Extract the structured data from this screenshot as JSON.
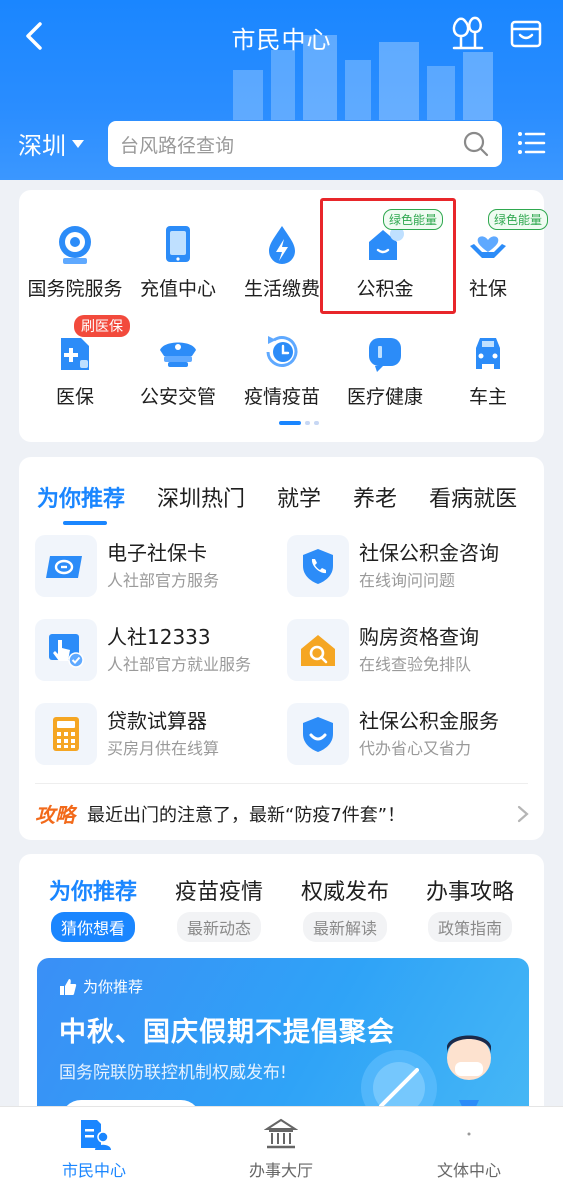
{
  "header": {
    "title": "市民中心",
    "city": "深圳",
    "search_placeholder": "台风路径查询"
  },
  "services": {
    "items": [
      {
        "label": "国务院服务",
        "icon": "state-council-emblem-icon"
      },
      {
        "label": "充值中心",
        "icon": "tablet-icon"
      },
      {
        "label": "生活缴费",
        "icon": "water-drop-bolt-icon"
      },
      {
        "label": "公积金",
        "icon": "house-fund-icon",
        "badge": "绿色能量"
      },
      {
        "label": "社保",
        "icon": "hands-heart-icon",
        "badge": "绿色能量"
      },
      {
        "label": "医保",
        "icon": "medical-card-icon",
        "badge": "刷医保"
      },
      {
        "label": "公安交管",
        "icon": "police-cap-icon"
      },
      {
        "label": "疫情疫苗",
        "icon": "clock-refresh-icon"
      },
      {
        "label": "医疗健康",
        "icon": "medical-chat-icon"
      },
      {
        "label": "车主",
        "icon": "car-icon"
      }
    ]
  },
  "recommend": {
    "tabs": [
      "为你推荐",
      "深圳热门",
      "就学",
      "养老",
      "看病就医"
    ],
    "items": [
      {
        "title": "电子社保卡",
        "subtitle": "人社部官方服务",
        "icon": "social-security-card-icon"
      },
      {
        "title": "社保公积金咨询",
        "subtitle": "在线询问问题",
        "icon": "shield-phone-icon"
      },
      {
        "title": "人社12333",
        "subtitle": "人社部官方就业服务",
        "icon": "touch-check-icon"
      },
      {
        "title": "购房资格查询",
        "subtitle": "在线查验免排队",
        "icon": "house-search-icon"
      },
      {
        "title": "贷款试算器",
        "subtitle": "买房月供在线算",
        "icon": "calculator-icon"
      },
      {
        "title": "社保公积金服务",
        "subtitle": "代办省心又省力",
        "icon": "shield-smile-icon"
      }
    ],
    "tip": {
      "tag": "攻略",
      "text": "最近出门的注意了，最新“防疫7件套”！"
    }
  },
  "news": {
    "tabs": [
      {
        "title": "为你推荐",
        "sub": "猜你想看"
      },
      {
        "title": "疫苗疫情",
        "sub": "最新动态"
      },
      {
        "title": "权威发布",
        "sub": "最新解读"
      },
      {
        "title": "办事攻略",
        "sub": "政策指南"
      }
    ],
    "banner": {
      "tag": "为你推荐",
      "title": "中秋、国庆假期不提倡聚会",
      "subtitle": "国务院联防联控机制权威发布!"
    }
  },
  "bottom_nav": [
    {
      "label": "市民中心",
      "icon": "citizen-center-icon"
    },
    {
      "label": "办事大厅",
      "icon": "government-hall-icon"
    },
    {
      "label": "文体中心",
      "icon": "culture-center-icon"
    }
  ],
  "colors": {
    "primary": "#1a86ff",
    "highlight_border": "#e8262a",
    "green_badge": "#2fa84f",
    "red_badge": "#f24a3c",
    "tip_orange": "#f26a1b"
  }
}
